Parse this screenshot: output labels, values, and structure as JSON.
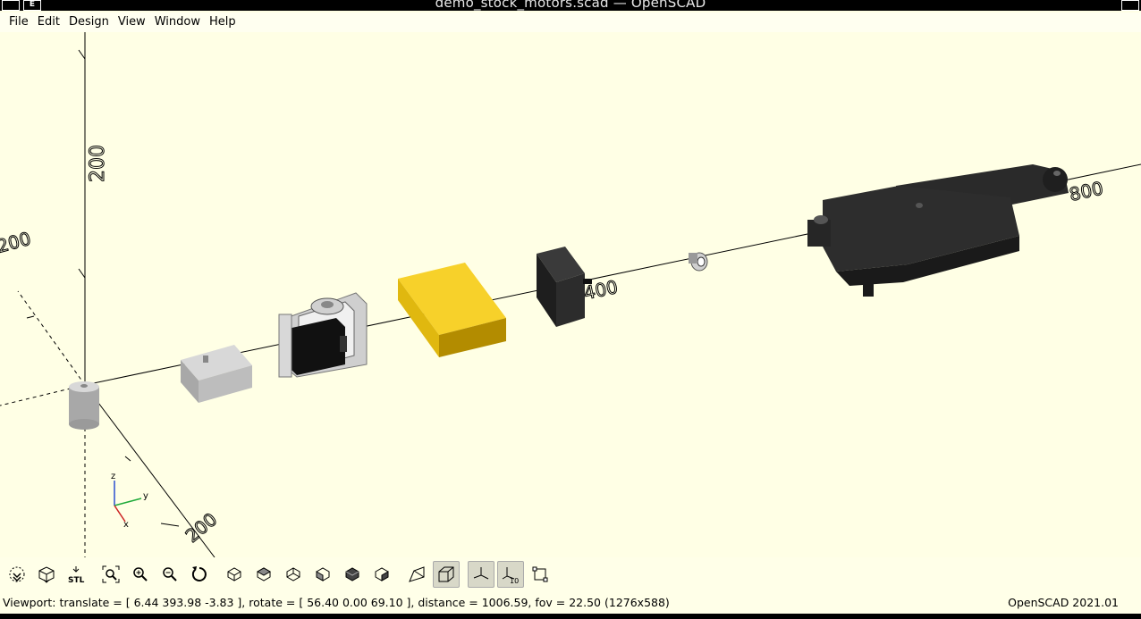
{
  "window": {
    "title": "demo_stock_motors.scad — OpenSCAD",
    "left_btn_1": "",
    "left_btn_2": "E"
  },
  "menu": [
    {
      "label": "File"
    },
    {
      "label": "Edit"
    },
    {
      "label": "Design"
    },
    {
      "label": "View"
    },
    {
      "label": "Window"
    },
    {
      "label": "Help"
    }
  ],
  "viewport": {
    "background": "#ffffe5",
    "axis_labels": {
      "z_top": "200",
      "x_far": "800",
      "x_mid": "400",
      "y_neg": "200",
      "left_edge": "200"
    },
    "gizmo": {
      "x": "x",
      "y": "y",
      "z": "z"
    }
  },
  "toolbar": {
    "icons": [
      {
        "name": "preview-icon",
        "active": false
      },
      {
        "name": "render-icon",
        "active": false
      },
      {
        "name": "export-stl-icon",
        "active": false,
        "label": "STL"
      },
      {
        "name": "view-all-icon",
        "active": false
      },
      {
        "name": "zoom-in-icon",
        "active": false
      },
      {
        "name": "zoom-out-icon",
        "active": false
      },
      {
        "name": "reset-view-icon",
        "active": false
      },
      {
        "name": "view-right-icon",
        "active": false
      },
      {
        "name": "view-top-icon",
        "active": false
      },
      {
        "name": "view-bottom-icon",
        "active": false
      },
      {
        "name": "view-left-icon",
        "active": false
      },
      {
        "name": "view-front-icon",
        "active": false
      },
      {
        "name": "view-back-icon",
        "active": false
      },
      {
        "name": "perspective-icon",
        "active": false
      },
      {
        "name": "orthogonal-icon",
        "active": true
      },
      {
        "name": "show-axes-icon",
        "active": true
      },
      {
        "name": "show-scale-markers-icon",
        "active": true,
        "label": "10"
      },
      {
        "name": "show-edges-icon",
        "active": false
      }
    ]
  },
  "status": {
    "viewport_info": "Viewport: translate = [ 6.44 393.98 -3.83 ], rotate = [ 56.40 0.00 69.10 ], distance = 1006.59, fov = 22.50 (1276x588)",
    "version": "OpenSCAD 2021.01"
  },
  "colors": {
    "yellow_box": "#f7d12a",
    "motor_dark": "#2b2b2b",
    "grey_part": "#b8b8b8"
  }
}
